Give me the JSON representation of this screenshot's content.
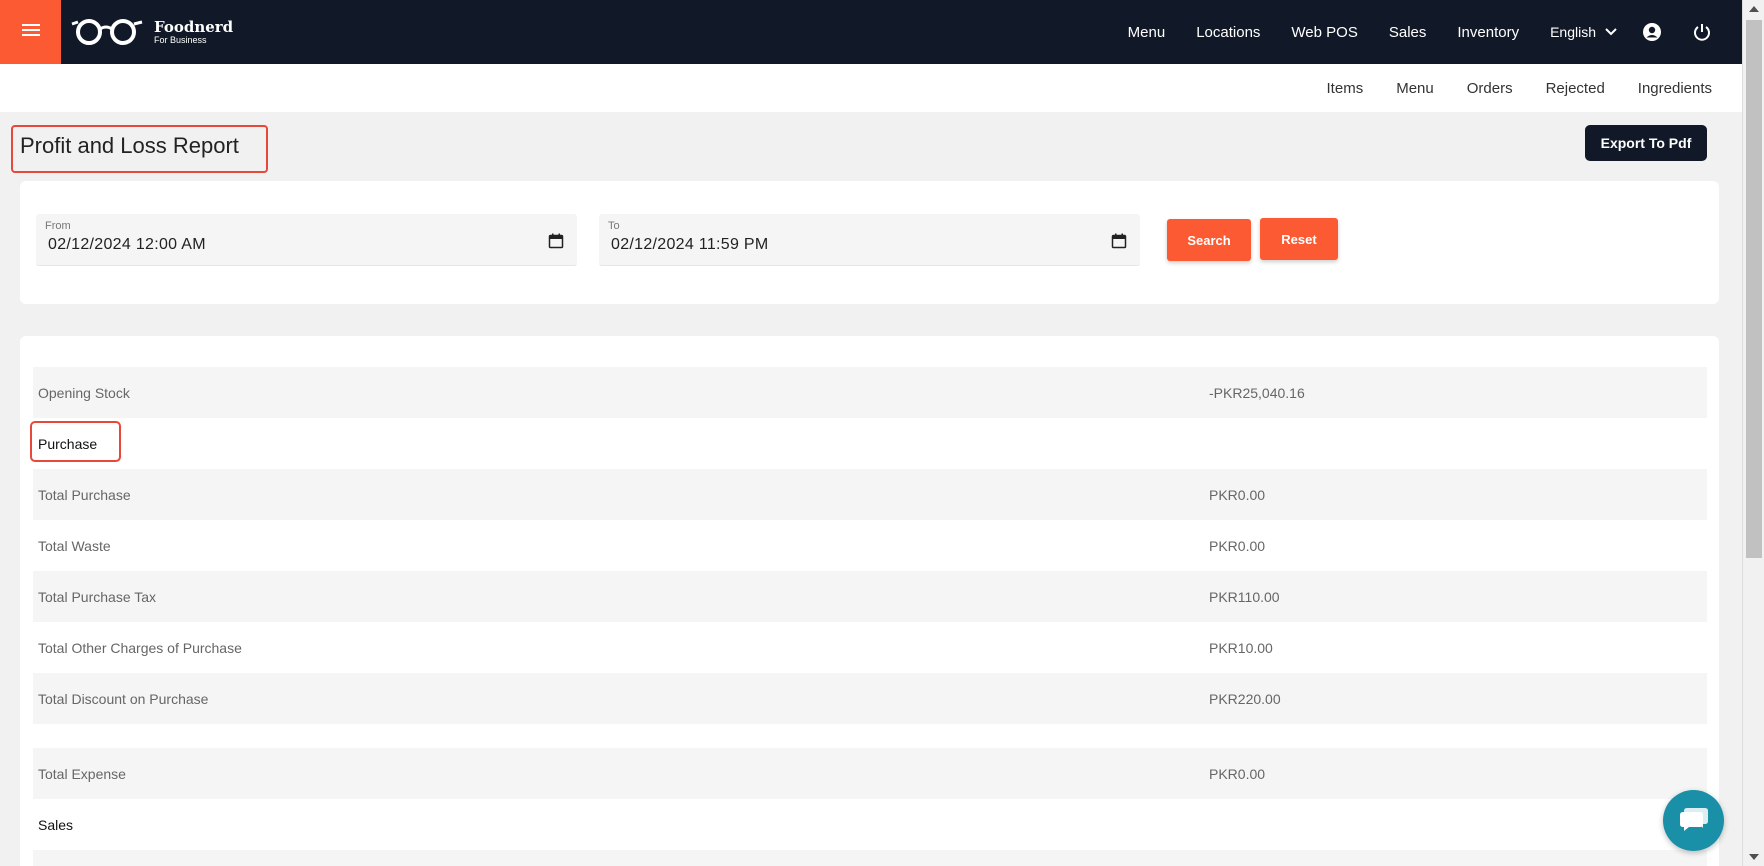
{
  "brand": {
    "name": "Foodnerd",
    "tagline": "For Business"
  },
  "topnav": {
    "items": [
      "Menu",
      "Locations",
      "Web POS",
      "Sales",
      "Inventory"
    ],
    "language": "English"
  },
  "subnav": {
    "items": [
      "Items",
      "Menu",
      "Orders",
      "Rejected",
      "Ingredients"
    ]
  },
  "page": {
    "title": "Profit and Loss Report",
    "export_label": "Export To Pdf"
  },
  "filters": {
    "from": {
      "label": "From",
      "value": "02/12/2024 12:00 AM"
    },
    "to": {
      "label": "To",
      "value": "02/12/2024 11:59 PM"
    },
    "search_label": "Search",
    "reset_label": "Reset"
  },
  "report": {
    "rows": [
      {
        "label": "Opening Stock",
        "value": "-PKR25,040.16"
      },
      {
        "label": "Purchase",
        "value": ""
      },
      {
        "label": "Total Purchase",
        "value": "PKR0.00"
      },
      {
        "label": "Total Waste",
        "value": "PKR0.00"
      },
      {
        "label": "Total Purchase Tax",
        "value": "PKR110.00"
      },
      {
        "label": "Total Other Charges of Purchase",
        "value": "PKR10.00"
      },
      {
        "label": "Total Discount on Purchase",
        "value": "PKR220.00"
      },
      {
        "label": "Total Expense",
        "value": "PKR0.00"
      },
      {
        "label": "Sales",
        "value": ""
      }
    ]
  },
  "colors": {
    "accent": "#fb5a32",
    "navbar": "#111827",
    "highlight": "#e8483a",
    "chat": "#1a8fa8"
  }
}
